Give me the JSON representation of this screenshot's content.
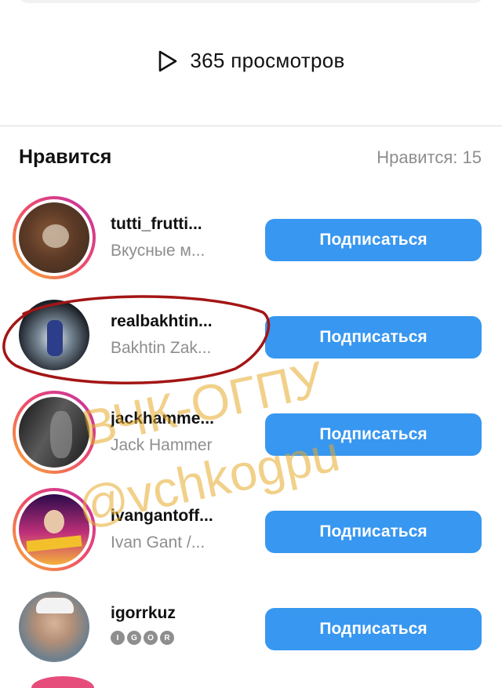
{
  "stats": {
    "views": "365 просмотров"
  },
  "likes_section": {
    "title": "Нравится",
    "count_label": "Нравится: 15"
  },
  "users": [
    {
      "username": "tutti_frutti...",
      "fullname": "Вкусные м...",
      "button": "Подписаться",
      "icon": "dog-photo"
    },
    {
      "username": "realbakhtin...",
      "fullname": "Bakhtin Zak...",
      "button": "Подписаться",
      "icon": "boxer-photo"
    },
    {
      "username": "jackhamme...",
      "fullname": "Jack Hammer",
      "button": "Подписаться",
      "icon": "bw-photo"
    },
    {
      "username": "ivangantoff...",
      "fullname": "Ivan Gant /...",
      "button": "Подписаться",
      "icon": "neon-photo"
    },
    {
      "username": "igorrkuz",
      "fullname_badges": [
        "I",
        "G",
        "O",
        "R"
      ],
      "button": "Подписаться",
      "icon": "man-photo"
    }
  ],
  "watermark": {
    "line1": "ВЧК-ОГПУ",
    "line2": "@vchkogpu"
  },
  "colors": {
    "accent": "#3897f0",
    "annotation": "#a31515",
    "watermark": "#e6aa28"
  }
}
